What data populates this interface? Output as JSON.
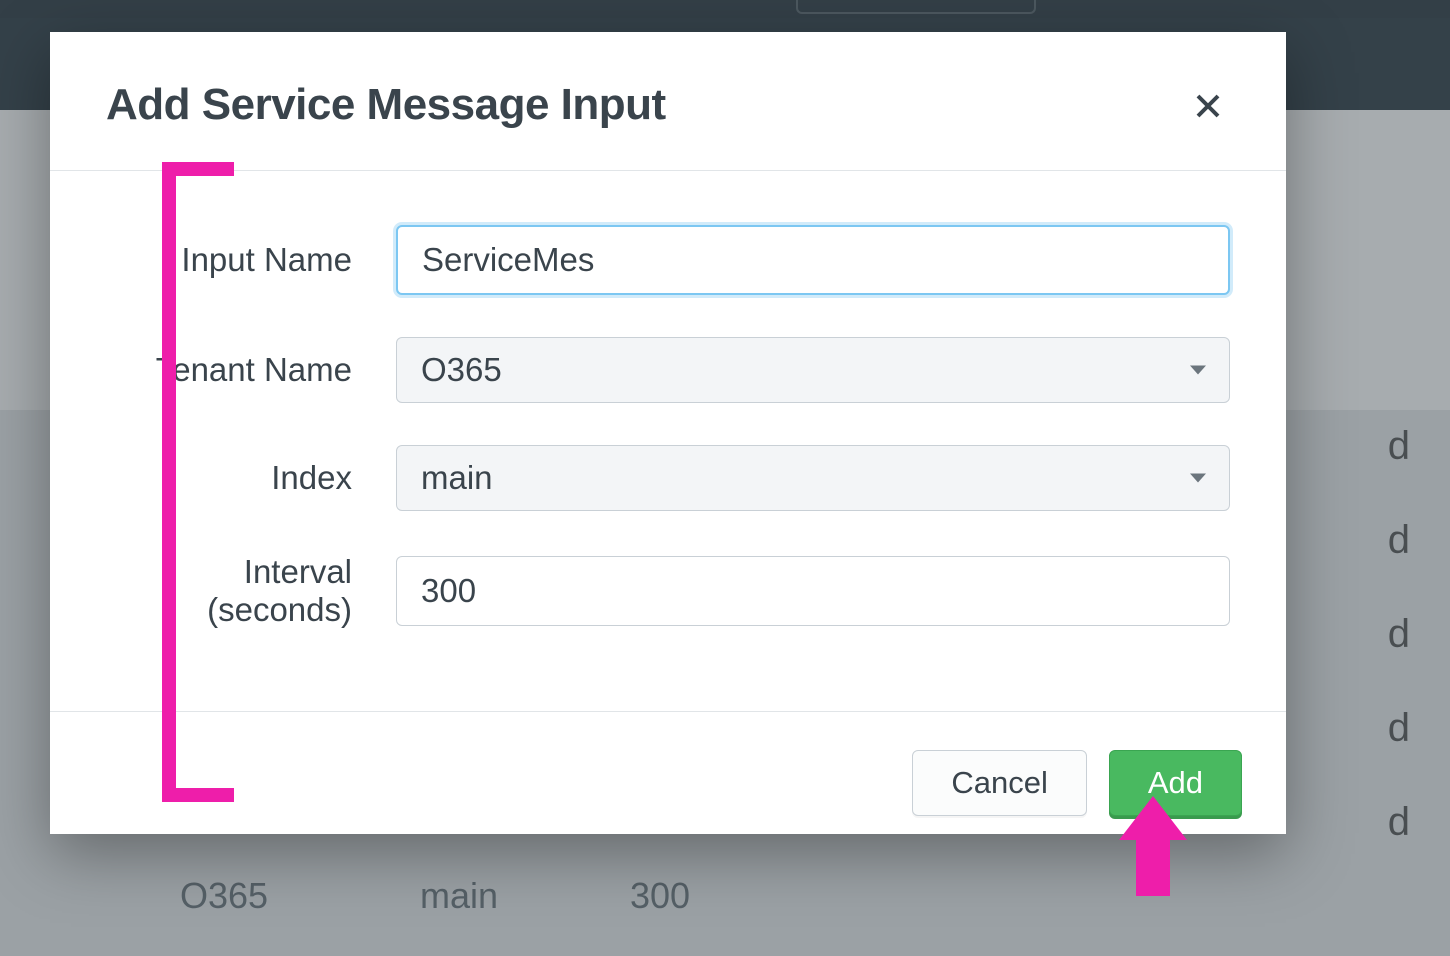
{
  "modal": {
    "title": "Add Service Message Input",
    "close_label": "Close"
  },
  "form": {
    "input_name": {
      "label": "Input Name",
      "value": "ServiceMes"
    },
    "tenant_name": {
      "label": "Tenant Name",
      "selected": "O365"
    },
    "index": {
      "label": "Index",
      "selected": "main"
    },
    "interval": {
      "label": "Interval (seconds)",
      "value": "300"
    }
  },
  "footer": {
    "cancel": "Cancel",
    "add": "Add"
  },
  "background": {
    "row_tenant": "O365",
    "row_index": "main",
    "row_interval": "300",
    "d": "d"
  }
}
